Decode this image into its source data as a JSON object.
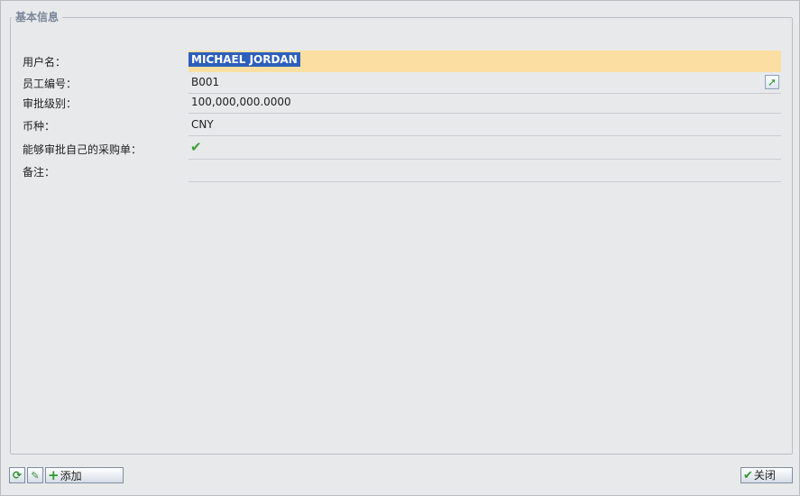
{
  "group_title": "基本信息",
  "fields": {
    "username": {
      "label": "用户名：",
      "value": "MICHAEL JORDAN"
    },
    "employee_no": {
      "label": "员工编号：",
      "value": "B001"
    },
    "approval_level": {
      "label": "审批级别：",
      "value": "100,000,000.0000"
    },
    "currency": {
      "label": "币种：",
      "value": "CNY"
    },
    "approve_own_po": {
      "label": "能够审批自己的采购单：",
      "checked": true
    },
    "remark": {
      "label": "备注：",
      "value": ""
    }
  },
  "toolbar": {
    "refresh_icon": "refresh-icon",
    "edit_icon": "edit-icon",
    "add_label": "添加",
    "close_label": "关闭"
  },
  "colors": {
    "highlight": "#fbdfa2",
    "selection": "#2d5fbd",
    "check": "#3aa135"
  }
}
